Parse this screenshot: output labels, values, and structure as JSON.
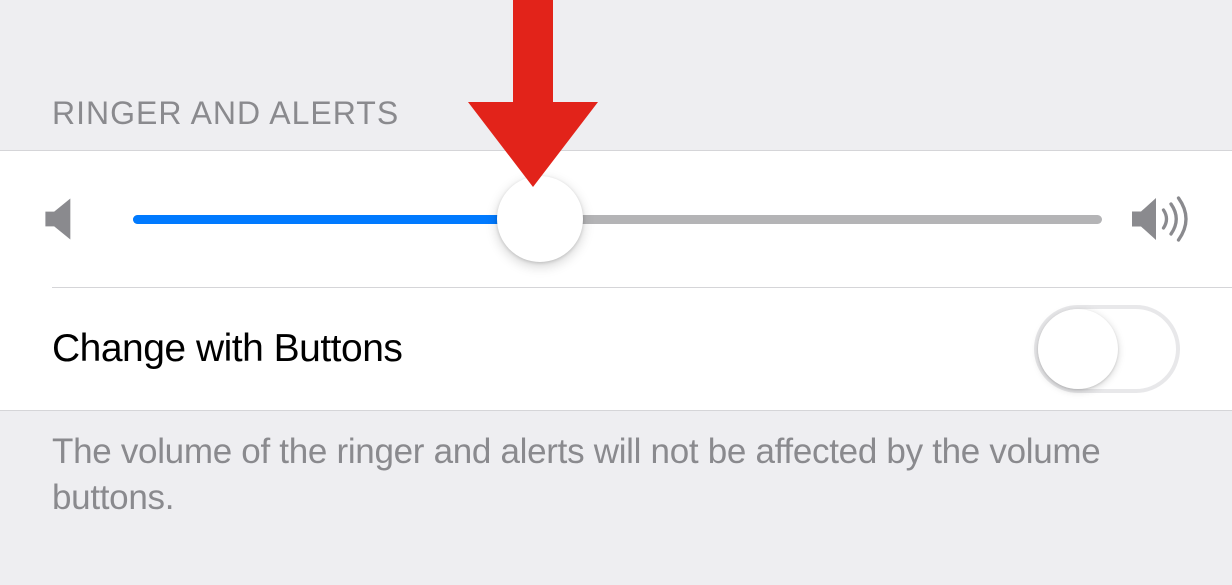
{
  "section": {
    "header": "RINGER AND ALERTS",
    "footer": "The volume of the ringer and alerts will not be affected by the volume buttons."
  },
  "slider": {
    "value_percent": 42
  },
  "toggle": {
    "label": "Change with Buttons",
    "on": false
  },
  "annotation": {
    "arrow_color": "#e2231a"
  }
}
